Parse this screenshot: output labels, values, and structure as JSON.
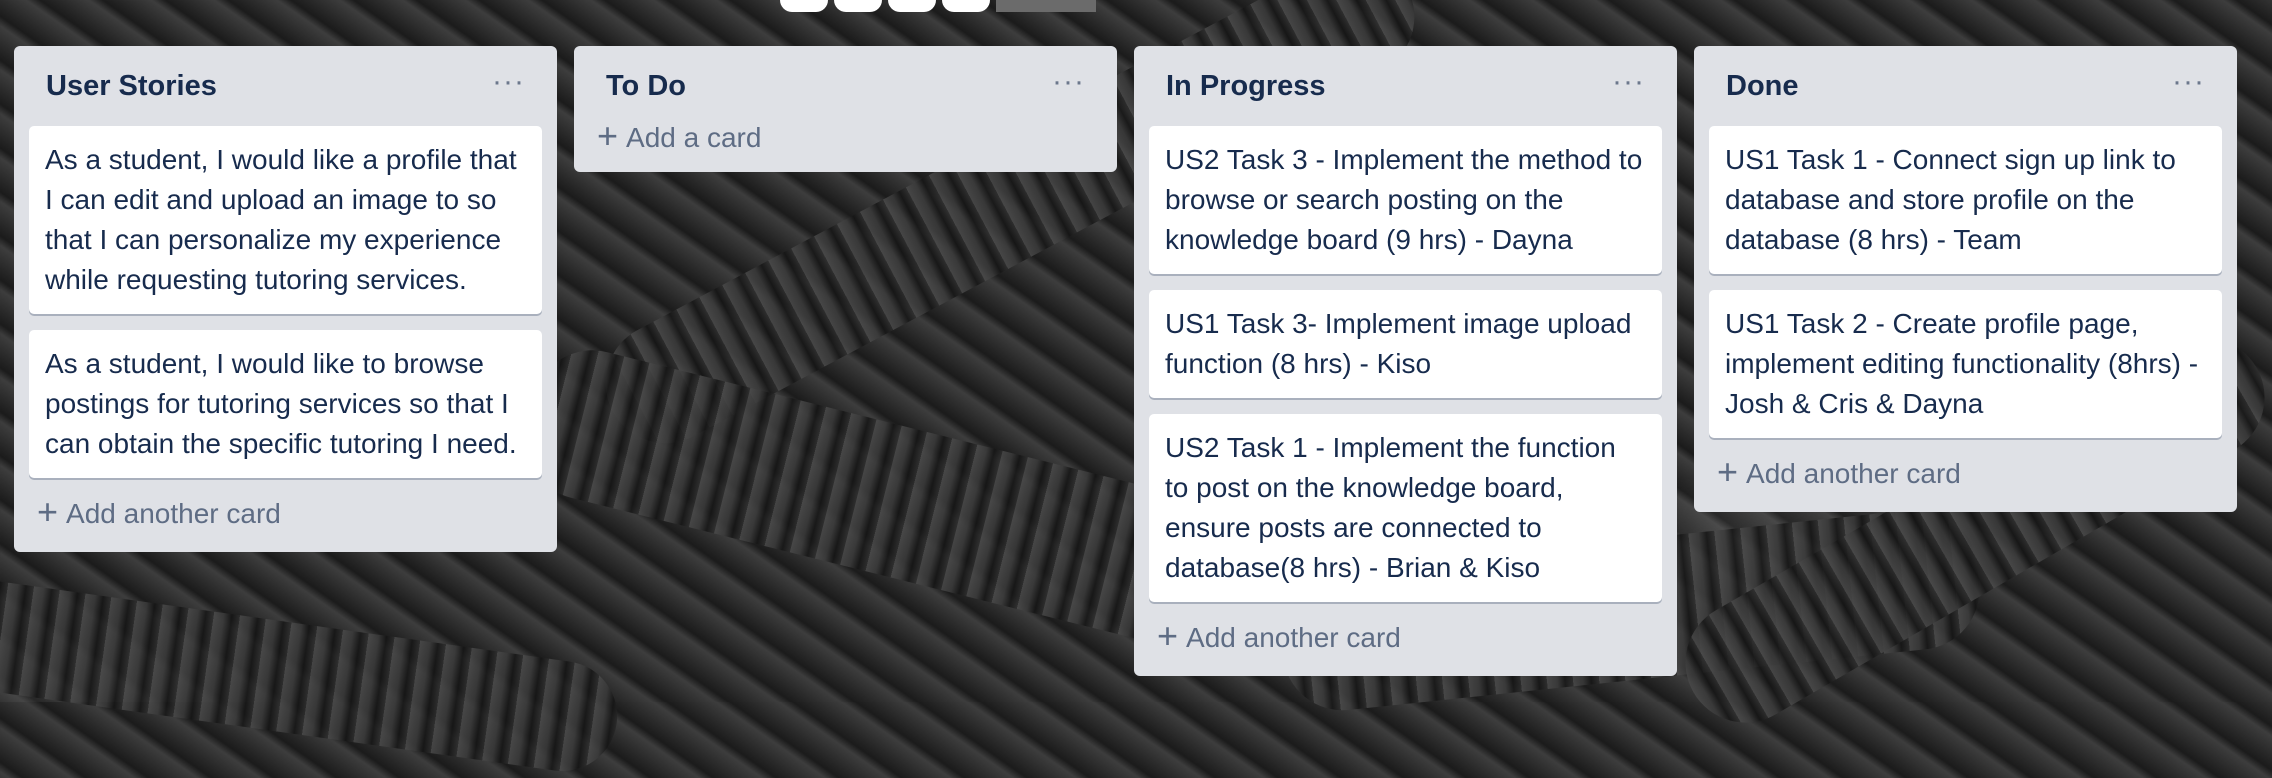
{
  "lists": [
    {
      "title": "User Stories",
      "cards": [
        "As a student, I would like a profile that I can edit and upload an image to so that I can personalize my experience while requesting tutoring services.",
        "As a student, I would like to browse postings for tutoring services so that I can obtain the specific tutoring I need."
      ],
      "add_label": "Add another card"
    },
    {
      "title": "To Do",
      "cards": [],
      "add_label": "Add a card"
    },
    {
      "title": "In Progress",
      "cards": [
        "US2 Task 3 - Implement the method to browse or search posting on the knowledge board (9 hrs) - Dayna",
        "US1 Task 3- Implement image upload function (8 hrs) - Kiso",
        "US2 Task 1 - Implement the function to post on the knowledge board, ensure posts are connected to database(8 hrs) - Brian & Kiso"
      ],
      "add_label": "Add another card"
    },
    {
      "title": "Done",
      "cards": [
        "US1 Task 1 - Connect sign up link to database and store profile on the database (8 hrs) - Team",
        "US1 Task 2 - Create profile page, implement editing functionality (8hrs) - Josh & Cris & Dayna"
      ],
      "add_label": "Add another card"
    }
  ],
  "icons": {
    "list_menu": "more-horizontal-icon",
    "add": "plus-icon"
  },
  "colors": {
    "list_background": "#dfe1e6",
    "card_background": "#ffffff",
    "title_text": "#172b4d",
    "muted_text": "#5e6c84"
  }
}
